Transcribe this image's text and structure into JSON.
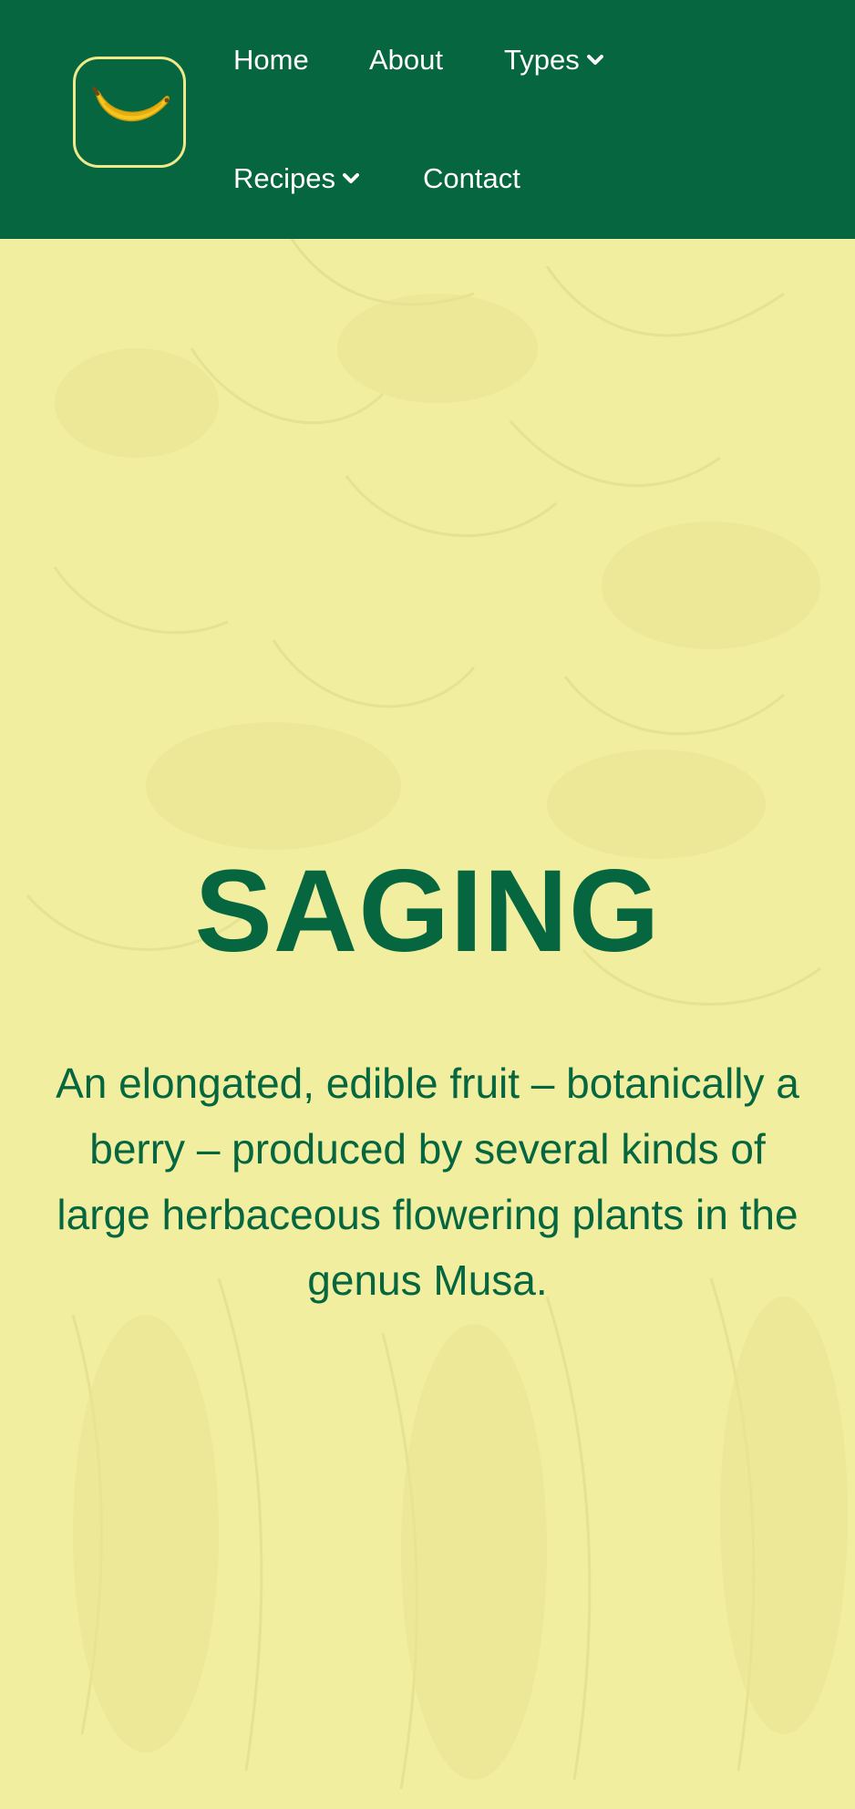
{
  "nav": {
    "logo_icon": "banana-icon",
    "items": [
      {
        "label": "Home",
        "dropdown": false
      },
      {
        "label": "About",
        "dropdown": false
      },
      {
        "label": "Types",
        "dropdown": true
      },
      {
        "label": "Recipes",
        "dropdown": true
      },
      {
        "label": "Contact",
        "dropdown": false
      }
    ]
  },
  "hero": {
    "title": "SAGING",
    "description": "An elongated, edible fruit – botanically a berry – produced by several kinds of large herbaceous flowering plants in the genus Musa."
  },
  "colors": {
    "header_bg": "#05663f",
    "hero_bg": "#f1ee9f",
    "text_green": "#05663f",
    "logo_border": "#f2e88a",
    "banana_yellow": "#f7c51e"
  }
}
